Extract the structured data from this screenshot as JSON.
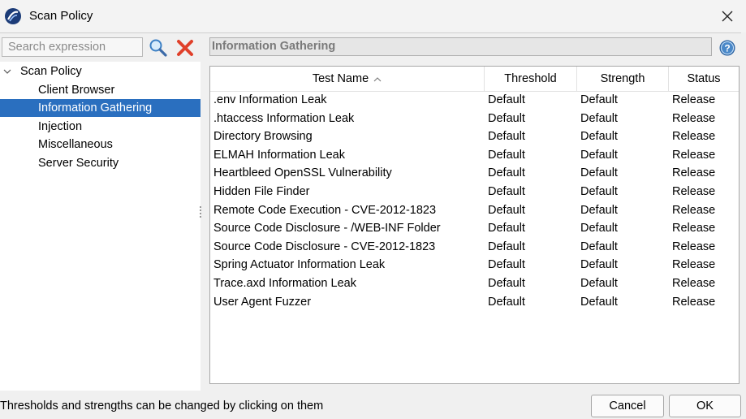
{
  "window": {
    "title": "Scan Policy",
    "close_icon": "close-icon"
  },
  "search": {
    "placeholder": "Search expression",
    "value": ""
  },
  "tree": {
    "root": "Scan Policy",
    "children": [
      "Client Browser",
      "Information Gathering",
      "Injection",
      "Miscellaneous",
      "Server Security"
    ],
    "selected": "Information Gathering"
  },
  "category": {
    "title": "Information Gathering"
  },
  "table": {
    "columns": [
      "Test Name",
      "Threshold",
      "Strength",
      "Status"
    ],
    "sort": {
      "column": "Test Name",
      "direction": "ascending"
    },
    "rows": [
      [
        ".env Information Leak",
        "Default",
        "Default",
        "Release"
      ],
      [
        ".htaccess Information Leak",
        "Default",
        "Default",
        "Release"
      ],
      [
        "Directory Browsing",
        "Default",
        "Default",
        "Release"
      ],
      [
        "ELMAH Information Leak",
        "Default",
        "Default",
        "Release"
      ],
      [
        "Heartbleed OpenSSL Vulnerability",
        "Default",
        "Default",
        "Release"
      ],
      [
        "Hidden File Finder",
        "Default",
        "Default",
        "Release"
      ],
      [
        "Remote Code Execution - CVE-2012-1823",
        "Default",
        "Default",
        "Release"
      ],
      [
        "Source Code Disclosure - /WEB-INF Folder",
        "Default",
        "Default",
        "Release"
      ],
      [
        "Source Code Disclosure - CVE-2012-1823",
        "Default",
        "Default",
        "Release"
      ],
      [
        "Spring Actuator Information Leak",
        "Default",
        "Default",
        "Release"
      ],
      [
        "Trace.axd Information Leak",
        "Default",
        "Default",
        "Release"
      ],
      [
        "User Agent Fuzzer",
        "Default",
        "Default",
        "Release"
      ]
    ]
  },
  "footer": {
    "hint": "Thresholds and strengths can be changed by clicking on them",
    "cancel_label": "Cancel",
    "ok_label": "OK"
  },
  "colors": {
    "selection": "#2a6fbf",
    "header_text": "#7a7a7a",
    "clear_icon": "#e0402a"
  }
}
